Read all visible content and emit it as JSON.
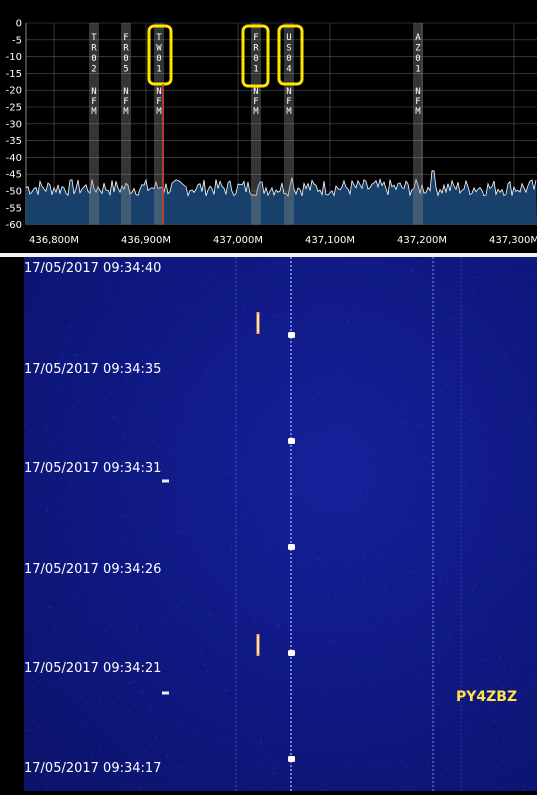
{
  "spectrum": {
    "y_axis_labels": [
      "0",
      "-5",
      "-10",
      "-15",
      "-20",
      "-25",
      "-30",
      "-35",
      "-40",
      "-45",
      "-50",
      "-55",
      "-60"
    ],
    "freq_labels": [
      "436,800M",
      "436,900M",
      "437,000M",
      "437,100M",
      "437,200M",
      "437,300M"
    ],
    "channels": [
      {
        "name": "TR02",
        "chars": [
          "T",
          "R",
          "0",
          "2"
        ],
        "mode": [
          "N",
          "F",
          "M"
        ],
        "highlighted": false
      },
      {
        "name": "FR05",
        "chars": [
          "F",
          "R",
          "0",
          "5"
        ],
        "mode": [
          "N",
          "F",
          "M"
        ],
        "highlighted": false
      },
      {
        "name": "TW01",
        "chars": [
          "T",
          "W",
          "0",
          "1"
        ],
        "mode": [
          "N",
          "F",
          "M"
        ],
        "highlighted": true
      },
      {
        "name": "FR01",
        "chars": [
          "F",
          "R",
          "0",
          "1"
        ],
        "mode": [
          "N",
          "F",
          "M"
        ],
        "highlighted": true
      },
      {
        "name": "US04",
        "chars": [
          "U",
          "S",
          "0",
          "4"
        ],
        "mode": [
          "N",
          "F",
          "M"
        ],
        "highlighted": true
      },
      {
        "name": "AZ01",
        "chars": [
          "A",
          "Z",
          "0",
          "1"
        ],
        "mode": [
          "N",
          "F",
          "M"
        ],
        "highlighted": false
      }
    ],
    "colors": {
      "highlight": "#ffe600",
      "noise_fill": "#17406a",
      "trace": "#ffffff",
      "tuned": "#d23c2c",
      "grid": "#555555"
    }
  },
  "waterfall": {
    "timestamps": [
      "17/05/2017 09:34:40",
      "17/05/2017 09:34:35",
      "17/05/2017 09:34:31",
      "17/05/2017 09:34:26",
      "17/05/2017 09:34:21",
      "17/05/2017 09:34:17"
    ],
    "callsign": "PY4ZBZ",
    "colors": {
      "background": "#0f1880",
      "signal": "#ffffff",
      "callsign": "#ffe34a"
    }
  }
}
